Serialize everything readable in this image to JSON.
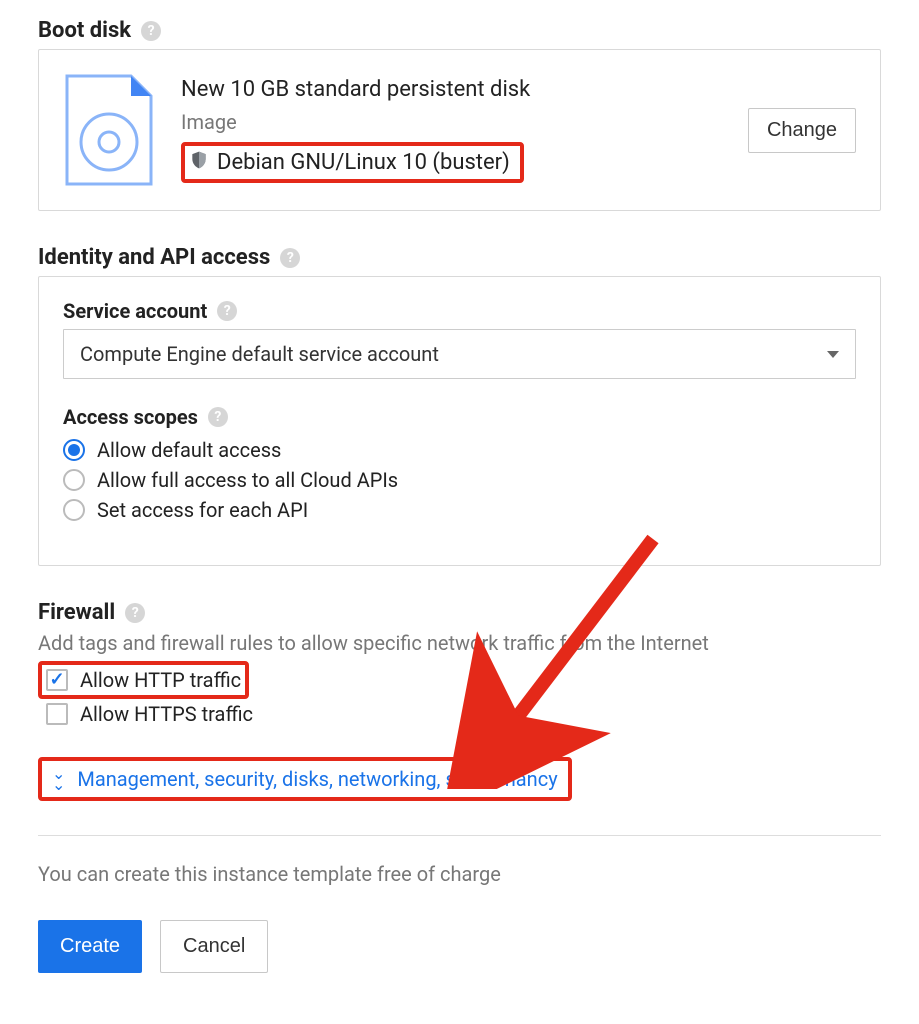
{
  "bootdisk": {
    "section_title": "Boot disk",
    "disk_title": "New 10 GB standard persistent disk",
    "image_label": "Image",
    "image_value": "Debian GNU/Linux 10 (buster)",
    "change_label": "Change"
  },
  "identity": {
    "section_title": "Identity and API access",
    "service_account_label": "Service account",
    "service_account_value": "Compute Engine default service account",
    "access_scopes_label": "Access scopes",
    "scopes": {
      "default": "Allow default access",
      "full": "Allow full access to all Cloud APIs",
      "each": "Set access for each API"
    }
  },
  "firewall": {
    "section_title": "Firewall",
    "help_text": "Add tags and firewall rules to allow specific network traffic from the Internet",
    "http_label": "Allow HTTP traffic",
    "https_label": "Allow HTTPS traffic"
  },
  "expander": {
    "label": "Management, security, disks, networking, sole tenancy"
  },
  "footer": {
    "free_text": "You can create this instance template free of charge",
    "create_label": "Create",
    "cancel_label": "Cancel"
  },
  "help_glyph": "?"
}
